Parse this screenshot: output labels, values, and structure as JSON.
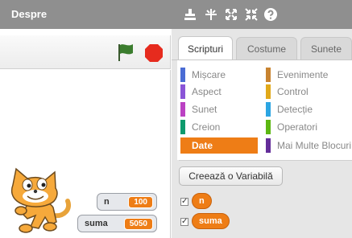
{
  "menu": {
    "about_label": "Despre"
  },
  "toolbar": {
    "icons": [
      "stamp-icon",
      "grow-icon",
      "expand-icon",
      "shrink-icon",
      "help-icon"
    ]
  },
  "stage": {
    "watchers": [
      {
        "label": "n",
        "value": "100"
      },
      {
        "label": "suma",
        "value": "5050"
      }
    ]
  },
  "tabs": [
    {
      "label": "Scripturi",
      "active": true
    },
    {
      "label": "Costume",
      "active": false
    },
    {
      "label": "Sunete",
      "active": false
    }
  ],
  "categories": [
    {
      "label": "Mișcare",
      "color": "#4a6cd4"
    },
    {
      "label": "Evenimente",
      "color": "#c88330"
    },
    {
      "label": "Aspect",
      "color": "#8a55d7"
    },
    {
      "label": "Control",
      "color": "#e1a91a"
    },
    {
      "label": "Sunet",
      "color": "#bb42c3"
    },
    {
      "label": "Detecție",
      "color": "#2ca5e2"
    },
    {
      "label": "Creion",
      "color": "#0e9a6c"
    },
    {
      "label": "Operatori",
      "color": "#5cb712"
    },
    {
      "label": "Date",
      "color": "#ee7d16",
      "active": true
    },
    {
      "label": "Mai Multe Blocuri",
      "color": "#632d99"
    }
  ],
  "palette": {
    "make_variable_label": "Creează o Variabilă",
    "variables": [
      {
        "name": "n",
        "checked": true
      },
      {
        "name": "suma",
        "checked": true
      }
    ]
  },
  "colors": {
    "menubar": "#8f8f8f",
    "data_orange": "#ee7d16",
    "stop_red": "#e62b1e",
    "flag_green": "#3b7d2e"
  }
}
